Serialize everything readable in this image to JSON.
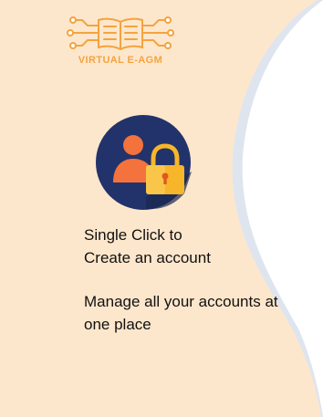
{
  "brand": {
    "logo_text": "VIRTUAL E-AGM",
    "logo_color": "#f4a340"
  },
  "hero": {
    "icon": "user-lock-icon",
    "circle_color": "#22336b",
    "user_color": "#f4723c",
    "lock_color": "#f7b52a"
  },
  "content": {
    "heading_line1": "Single Click to",
    "heading_line2": "Create an account",
    "description_line1": "Manage all your accounts at",
    "description_line2": "one place"
  },
  "colors": {
    "panel_background": "#fde7cc",
    "curve_fill": "#ffffff",
    "curve_shadow": "#dfe5ef"
  }
}
